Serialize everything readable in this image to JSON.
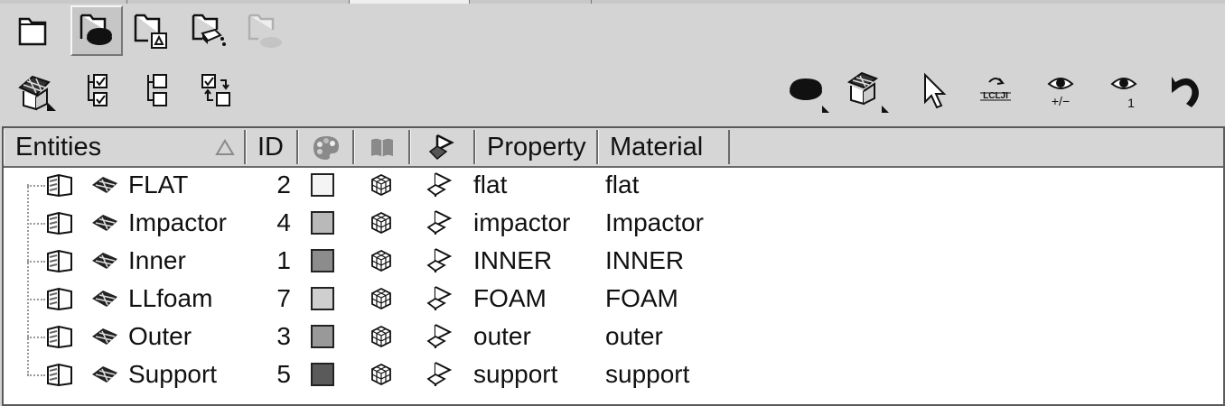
{
  "window": {
    "tabs_visible": 3
  },
  "toolbar_top": {
    "buttons": [
      {
        "name": "component-view-icon",
        "pressed": false
      },
      {
        "name": "component-solid-view-icon",
        "pressed": true
      },
      {
        "name": "component-assembly-view-icon",
        "pressed": false
      },
      {
        "name": "component-settings-view-icon",
        "pressed": false
      },
      {
        "name": "component-disabled-view-icon",
        "pressed": false,
        "disabled": true
      }
    ]
  },
  "toolbar_secondary": {
    "left_buttons": [
      "component-entity-icon",
      "expand-checked-icon",
      "tree-structure-icon",
      "swap-checked-icon"
    ],
    "right_buttons": [
      "solid-display-icon",
      "elements-display-icon",
      "select-pointer-icon",
      "reset-view-icon",
      "show-hide-icon",
      "isolate-icon",
      "undo-icon"
    ],
    "reset_view_label": "LCLJI",
    "show_hide_label": "+/−",
    "isolate_label": "1"
  },
  "table": {
    "columns": {
      "entities": "Entities",
      "id": "ID",
      "color": "",
      "include": "",
      "card": "",
      "property": "Property",
      "material": "Material"
    },
    "rows": [
      {
        "name": "FLAT",
        "id": "2",
        "color": "#f4f4f4",
        "property": "flat",
        "material": "flat"
      },
      {
        "name": "Impactor",
        "id": "4",
        "color": "#b9b9b9",
        "property": "impactor",
        "material": "Impactor"
      },
      {
        "name": "Inner",
        "id": "1",
        "color": "#8c8c8c",
        "property": "INNER",
        "material": "INNER"
      },
      {
        "name": "LLfoam",
        "id": "7",
        "color": "#cfcfcf",
        "property": "FOAM",
        "material": "FOAM"
      },
      {
        "name": "Outer",
        "id": "3",
        "color": "#999999",
        "property": "outer",
        "material": "outer"
      },
      {
        "name": "Support",
        "id": "5",
        "color": "#5a5a5a",
        "property": "support",
        "material": "support"
      }
    ]
  }
}
